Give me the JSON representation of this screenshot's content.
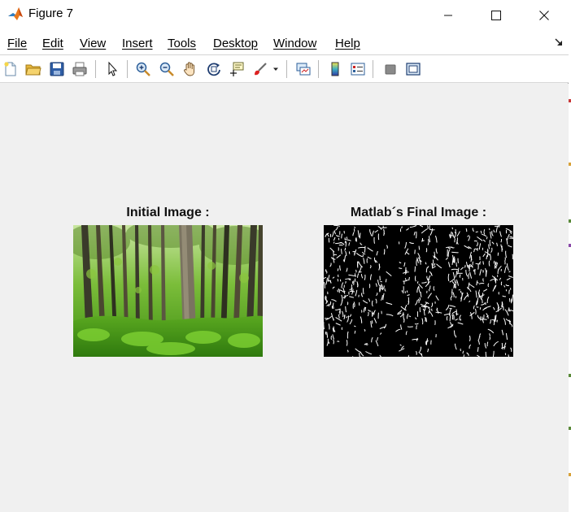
{
  "window": {
    "title": "Figure 7",
    "controls": [
      "minimize",
      "maximize",
      "close"
    ]
  },
  "menu": {
    "items": [
      {
        "label": "File",
        "key": "file"
      },
      {
        "label": "Edit",
        "key": "edit"
      },
      {
        "label": "View",
        "key": "view"
      },
      {
        "label": "Insert",
        "key": "insert"
      },
      {
        "label": "Tools",
        "key": "tools"
      },
      {
        "label": "Desktop",
        "key": "desktop"
      },
      {
        "label": "Window",
        "key": "window"
      },
      {
        "label": "Help",
        "key": "help"
      }
    ]
  },
  "toolbar": {
    "buttons": [
      "new-figure-icon",
      "open-file-icon",
      "save-icon",
      "print-icon",
      "edit-plot-arrow-icon",
      "zoom-in-icon",
      "zoom-out-icon",
      "pan-hand-icon",
      "rotate-3d-icon",
      "data-cursor-icon",
      "brush-icon",
      "brush-dropdown-icon",
      "link-plot-icon",
      "insert-colorbar-icon",
      "insert-legend-icon",
      "hide-plot-tools-icon",
      "show-plot-tools-icon"
    ]
  },
  "figure": {
    "left_axes": {
      "title": "Initial Image :",
      "content": "forest photo"
    },
    "right_axes": {
      "title": "Matlab´s Final Image :",
      "content": "binary edge map"
    }
  }
}
